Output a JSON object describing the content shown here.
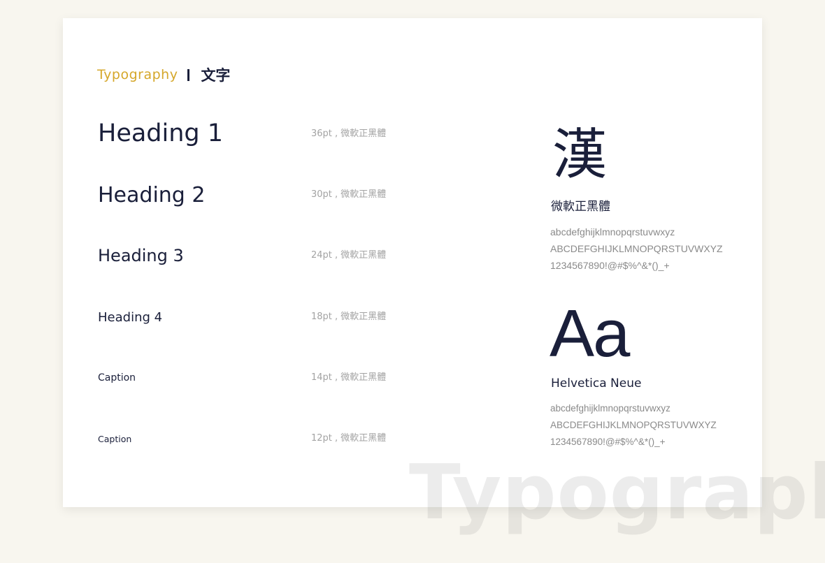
{
  "section_title": {
    "en": "Typography",
    "zh": "文字"
  },
  "type_scale": [
    {
      "label": "Heading 1",
      "spec": "36pt , 微軟正黑體"
    },
    {
      "label": "Heading 2",
      "spec": "30pt , 微軟正黑體"
    },
    {
      "label": "Heading 3",
      "spec": "24pt , 微軟正黑體"
    },
    {
      "label": "Heading 4",
      "spec": "18pt , 微軟正黑體"
    },
    {
      "label": "Caption",
      "spec": "14pt , 微軟正黑體"
    },
    {
      "label": "Caption",
      "spec": "12pt , 微軟正黑體"
    }
  ],
  "specimens": [
    {
      "glyph": "漢",
      "font_name": "微軟正黑體",
      "lowercase": "abcdefghijklmnopqrstuvwxyz",
      "uppercase": "ABCDEFGHIJKLMNOPQRSTUVWXYZ",
      "digits_symbols": "1234567890!@#$%^&*()_+"
    },
    {
      "glyph": "Aa",
      "font_name": "Helvetica Neue",
      "lowercase": "abcdefghijklmnopqrstuvwxyz",
      "uppercase": "ABCDEFGHIJKLMNOPQRSTUVWXYZ",
      "digits_symbols": "1234567890!@#$%^&*()_+"
    }
  ],
  "watermark": "Typography",
  "colors": {
    "accent": "#d5a72a",
    "ink": "#1a1f3a",
    "muted": "#a3a3a3",
    "background": "#f8f6ef",
    "card": "#ffffff"
  }
}
